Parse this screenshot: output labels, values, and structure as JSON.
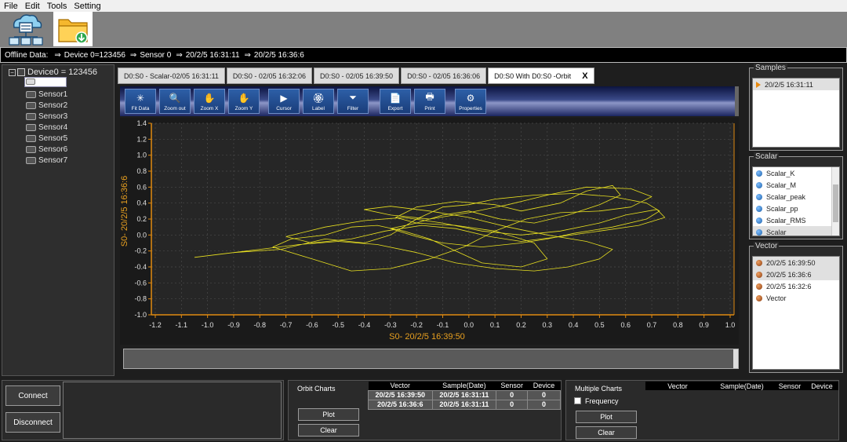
{
  "menu": [
    "File",
    "Edit",
    "Tools",
    "Setting"
  ],
  "offline": {
    "label": "Offline Data:",
    "device": "Device 0=123456",
    "sensor": "Sensor 0",
    "time_start": "20/2/5 16:31:11",
    "time_end": "20/2/5 16:36:6",
    "arrow": "⇒"
  },
  "tree": {
    "root": "Device0 = 123456",
    "sensors": [
      "Sensor1",
      "Sensor2",
      "Sensor3",
      "Sensor4",
      "Sensor5",
      "Sensor6",
      "Sensor7"
    ]
  },
  "tabs": [
    "D0:S0 - Scalar-02/05 16:31:11",
    "D0:S0 - 02/05 16:32:06",
    "D0:S0 - 02/05 16:39:50",
    "D0:S0 - 02/05 16:36:06",
    "D0:S0 With D0:S0 -Orbit"
  ],
  "tab_close": "X",
  "chart_toolbar": [
    {
      "label": "Fit Data",
      "icon": "fit-data-icon",
      "glyph": "✳"
    },
    {
      "label": "Zoom out",
      "icon": "zoom-out-icon",
      "glyph": "🔍"
    },
    {
      "label": "Zoom X",
      "icon": "zoom-x-icon",
      "glyph": "✋"
    },
    {
      "label": "Zoom Y",
      "icon": "zoom-y-icon",
      "glyph": "✋"
    },
    {
      "label": "Cursor",
      "icon": "cursor-icon",
      "glyph": "▶"
    },
    {
      "label": "Label",
      "icon": "label-icon",
      "glyph": "🏵"
    },
    {
      "label": "Filter",
      "icon": "filter-icon",
      "glyph": "⏷"
    },
    {
      "label": "Export",
      "icon": "export-icon",
      "glyph": "📄"
    },
    {
      "label": "Print",
      "icon": "print-icon",
      "glyph": "🖶"
    },
    {
      "label": "Properties",
      "icon": "properties-icon",
      "glyph": "⚙"
    }
  ],
  "chart_data": {
    "type": "line",
    "xlabel": "S0- 20/2/5 16:39:50",
    "ylabel": "S0- 20/2/5 16:36:6",
    "xlim": [
      -1.2,
      1.0
    ],
    "ylim": [
      -1.0,
      1.4
    ],
    "xticks": [
      "-1.2",
      "-1.1",
      "-1.0",
      "-0.9",
      "-0.8",
      "-0.7",
      "-0.6",
      "-0.5",
      "-0.4",
      "-0.3",
      "-0.2",
      "-0.1",
      "0.0",
      "0.1",
      "0.2",
      "0.3",
      "0.4",
      "0.5",
      "0.6",
      "0.7",
      "0.8",
      "0.9",
      "1.0"
    ],
    "yticks": [
      "1.4",
      "1.2",
      "1.0",
      "0.8",
      "0.6",
      "0.4",
      "0.2",
      "0.0",
      "-0.2",
      "-0.4",
      "-0.6",
      "-0.8",
      "-1.0"
    ],
    "grid": true,
    "colors": {
      "line": "#e8e020",
      "axis": "#e08a10",
      "label": "#e8a020"
    },
    "series": [
      {
        "points": [
          [
            -1.05,
            -0.28
          ],
          [
            -0.9,
            -0.22
          ],
          [
            -0.72,
            -0.18
          ],
          [
            -0.55,
            -0.05
          ],
          [
            -0.4,
            -0.1
          ],
          [
            -0.3,
            0.0
          ],
          [
            -0.2,
            0.2
          ],
          [
            -0.1,
            0.35
          ],
          [
            0.0,
            0.38
          ],
          [
            0.1,
            0.45
          ],
          [
            0.25,
            0.5
          ],
          [
            0.4,
            0.52
          ],
          [
            0.55,
            0.48
          ],
          [
            0.68,
            0.4
          ],
          [
            0.73,
            0.3
          ],
          [
            0.68,
            0.2
          ],
          [
            0.55,
            0.1
          ],
          [
            0.4,
            0.02
          ],
          [
            0.3,
            -0.05
          ],
          [
            0.2,
            -0.1
          ],
          [
            0.05,
            -0.15
          ],
          [
            -0.1,
            -0.1
          ],
          [
            -0.2,
            -0.02
          ],
          [
            -0.3,
            0.08
          ],
          [
            -0.2,
            0.15
          ],
          [
            -0.05,
            0.12
          ],
          [
            0.1,
            0.05
          ],
          [
            0.25,
            -0.1
          ],
          [
            0.3,
            -0.3
          ],
          [
            0.2,
            -0.4
          ],
          [
            0.05,
            -0.35
          ],
          [
            -0.05,
            -0.2
          ],
          [
            -0.15,
            -0.05
          ],
          [
            -0.25,
            0.05
          ],
          [
            -0.35,
            0.12
          ],
          [
            -0.45,
            0.1
          ],
          [
            -0.55,
            0.0
          ],
          [
            -0.68,
            -0.05
          ],
          [
            -0.75,
            -0.15
          ],
          [
            -0.6,
            -0.3
          ],
          [
            -0.45,
            -0.45
          ],
          [
            -0.3,
            -0.42
          ],
          [
            -0.15,
            -0.3
          ],
          [
            -0.02,
            -0.15
          ],
          [
            0.1,
            0.05
          ],
          [
            0.22,
            0.2
          ],
          [
            0.35,
            0.28
          ],
          [
            0.5,
            0.3
          ],
          [
            0.62,
            0.35
          ],
          [
            0.7,
            0.48
          ],
          [
            0.62,
            0.58
          ],
          [
            0.45,
            0.6
          ],
          [
            0.3,
            0.5
          ],
          [
            0.15,
            0.38
          ],
          [
            0.0,
            0.28
          ],
          [
            -0.15,
            0.2
          ],
          [
            -0.3,
            0.25
          ],
          [
            -0.4,
            0.32
          ],
          [
            -0.3,
            0.36
          ],
          [
            -0.15,
            0.3
          ],
          [
            0.0,
            0.22
          ],
          [
            0.15,
            0.1
          ],
          [
            0.3,
            0.0
          ],
          [
            0.45,
            -0.08
          ],
          [
            0.55,
            -0.18
          ],
          [
            0.5,
            -0.3
          ],
          [
            0.38,
            -0.4
          ],
          [
            0.25,
            -0.45
          ],
          [
            0.1,
            -0.42
          ],
          [
            -0.05,
            -0.35
          ],
          [
            -0.2,
            -0.22
          ],
          [
            -0.35,
            -0.12
          ],
          [
            -0.5,
            -0.08
          ],
          [
            -0.65,
            -0.12
          ],
          [
            -0.8,
            -0.18
          ],
          [
            -0.95,
            -0.24
          ],
          [
            -1.05,
            -0.28
          ]
        ]
      },
      {
        "points": [
          [
            -0.7,
            -0.02
          ],
          [
            -0.55,
            0.1
          ],
          [
            -0.4,
            0.18
          ],
          [
            -0.25,
            0.22
          ],
          [
            -0.1,
            0.15
          ],
          [
            0.05,
            0.05
          ],
          [
            0.2,
            0.0
          ],
          [
            0.35,
            0.05
          ],
          [
            0.5,
            0.15
          ],
          [
            0.6,
            0.25
          ],
          [
            0.72,
            0.32
          ],
          [
            0.75,
            0.22
          ],
          [
            0.65,
            0.12
          ],
          [
            0.5,
            0.05
          ],
          [
            0.35,
            -0.02
          ],
          [
            0.2,
            -0.08
          ],
          [
            0.08,
            -0.02
          ],
          [
            -0.05,
            0.08
          ],
          [
            -0.18,
            0.12
          ],
          [
            -0.32,
            0.05
          ],
          [
            -0.45,
            -0.05
          ],
          [
            -0.6,
            -0.1
          ],
          [
            -0.7,
            -0.02
          ]
        ]
      },
      {
        "points": [
          [
            -0.2,
            0.35
          ],
          [
            -0.05,
            0.42
          ],
          [
            0.1,
            0.38
          ],
          [
            0.2,
            0.3
          ],
          [
            0.35,
            0.4
          ],
          [
            0.45,
            0.55
          ],
          [
            0.55,
            0.62
          ],
          [
            0.58,
            0.5
          ],
          [
            0.5,
            0.38
          ],
          [
            0.38,
            0.25
          ],
          [
            0.25,
            0.15
          ],
          [
            0.12,
            0.2
          ],
          [
            0.0,
            0.3
          ],
          [
            -0.1,
            0.25
          ],
          [
            -0.2,
            0.15
          ],
          [
            -0.28,
            0.22
          ],
          [
            -0.2,
            0.35
          ]
        ]
      }
    ]
  },
  "samples": {
    "title": "Samples",
    "items": [
      "20/2/5 16:31:11"
    ]
  },
  "scalar": {
    "title": "Scalar",
    "items": [
      "Scalar_K",
      "Scalar_M",
      "Scalar_peak",
      "Scalar_pp",
      "Scalar_RMS",
      "Scalar"
    ]
  },
  "vector": {
    "title": "Vector",
    "items": [
      "20/2/5 16:39:50",
      "20/2/5 16:36:6",
      "20/2/5 16:32:6",
      "Vector"
    ]
  },
  "connect_label": "Connect",
  "disconnect_label": "Disconnect",
  "orbit": {
    "title": "Orbit Charts",
    "plot": "Plot",
    "clear": "Clear",
    "headers": [
      "Vector",
      "Sample(Date)",
      "Sensor",
      "Device"
    ],
    "rows": [
      [
        "20/2/5 16:39:50",
        "20/2/5 16:31:11",
        "0",
        "0"
      ],
      [
        "20/2/5 16:36:6",
        "20/2/5 16:31:11",
        "0",
        "0"
      ]
    ]
  },
  "multiple": {
    "title": "Multiple Charts",
    "frequency": "Frequency",
    "plot": "Plot",
    "clear": "Clear",
    "headers": [
      "Vector",
      "Sample(Date)",
      "Sensor",
      "Device"
    ]
  }
}
